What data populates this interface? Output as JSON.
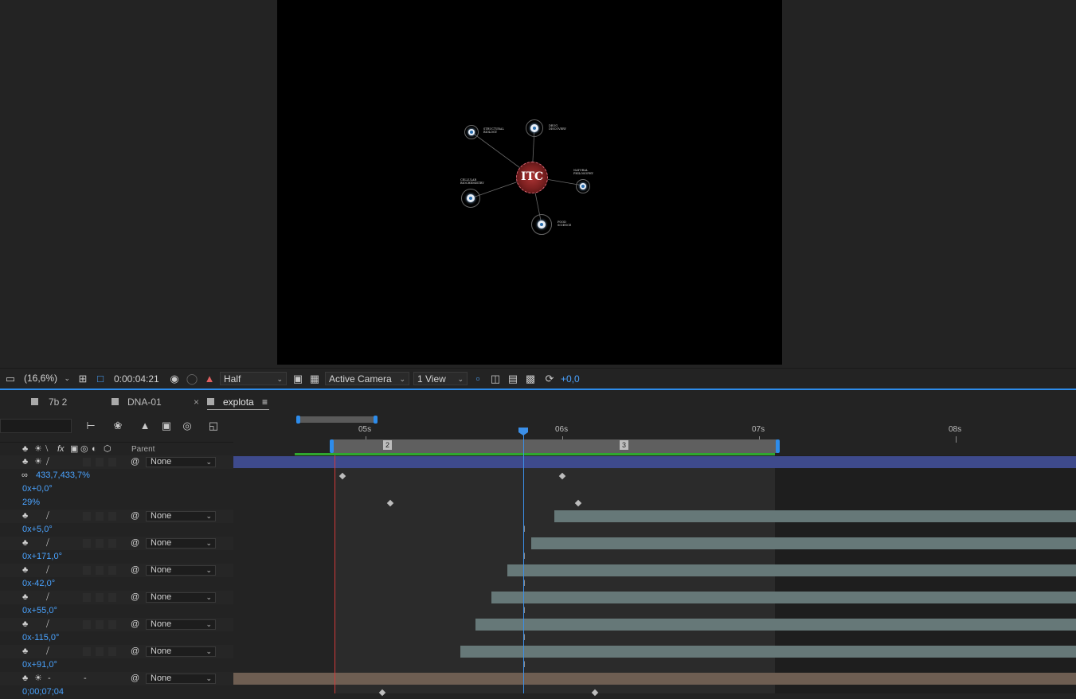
{
  "viewer": {
    "center_label": "ITC",
    "nodes": [
      {
        "label": "Structural Biology",
        "id": "n1"
      },
      {
        "label": "Drug Discovery",
        "id": "n2"
      },
      {
        "label": "Natural Philosophy",
        "id": "n3"
      },
      {
        "label": "Cellular Biochemistry",
        "id": "n4"
      },
      {
        "label": "Food Science",
        "id": "n5"
      }
    ]
  },
  "toolbar": {
    "zoom": "(16,6%)",
    "timecode": "0:00:04:21",
    "resolution": "Half",
    "camera": "Active Camera",
    "views": "1 View",
    "exposure": "+0,0"
  },
  "tabs": [
    {
      "label": "7b 2",
      "color": "#a9a9a9"
    },
    {
      "label": "DNA-01",
      "color": "#a9a9a9"
    },
    {
      "label": "explota",
      "color": "#a9a9a9",
      "active": true
    }
  ],
  "ruler": {
    "ticks": [
      "05s",
      "06s",
      "07s",
      "08s"
    ],
    "markers": [
      "2",
      "3"
    ]
  },
  "columns": {
    "parent_header": "Parent"
  },
  "rows": [
    {
      "type": "layer",
      "parent": "None"
    },
    {
      "type": "prop",
      "value": "433,7,433,7%",
      "linked": true
    },
    {
      "type": "prop",
      "value": "0x+0,0°"
    },
    {
      "type": "prop",
      "value": "29%"
    },
    {
      "type": "layer",
      "parent": "None"
    },
    {
      "type": "prop",
      "value": "0x+5,0°"
    },
    {
      "type": "layer",
      "parent": "None"
    },
    {
      "type": "prop",
      "value": "0x+171,0°"
    },
    {
      "type": "layer",
      "parent": "None"
    },
    {
      "type": "prop",
      "value": "0x-42,0°"
    },
    {
      "type": "layer",
      "parent": "None"
    },
    {
      "type": "prop",
      "value": "0x+55,0°"
    },
    {
      "type": "layer",
      "parent": "None"
    },
    {
      "type": "prop",
      "value": "0x-115,0°"
    },
    {
      "type": "layer",
      "parent": "None"
    },
    {
      "type": "prop",
      "value": "0x+91,0°"
    },
    {
      "type": "layer",
      "parent": "None"
    },
    {
      "type": "prop",
      "value": "0;00;07;04"
    }
  ],
  "colors": {
    "accent": "#2d8ceb",
    "layer_bar_blue": "#3e4a8c",
    "layer_bar_grey": "#667878",
    "layer_bar_tan": "#6e5e52",
    "work_area_green": "#2fa72f",
    "in_point_red": "#d23a3a"
  }
}
